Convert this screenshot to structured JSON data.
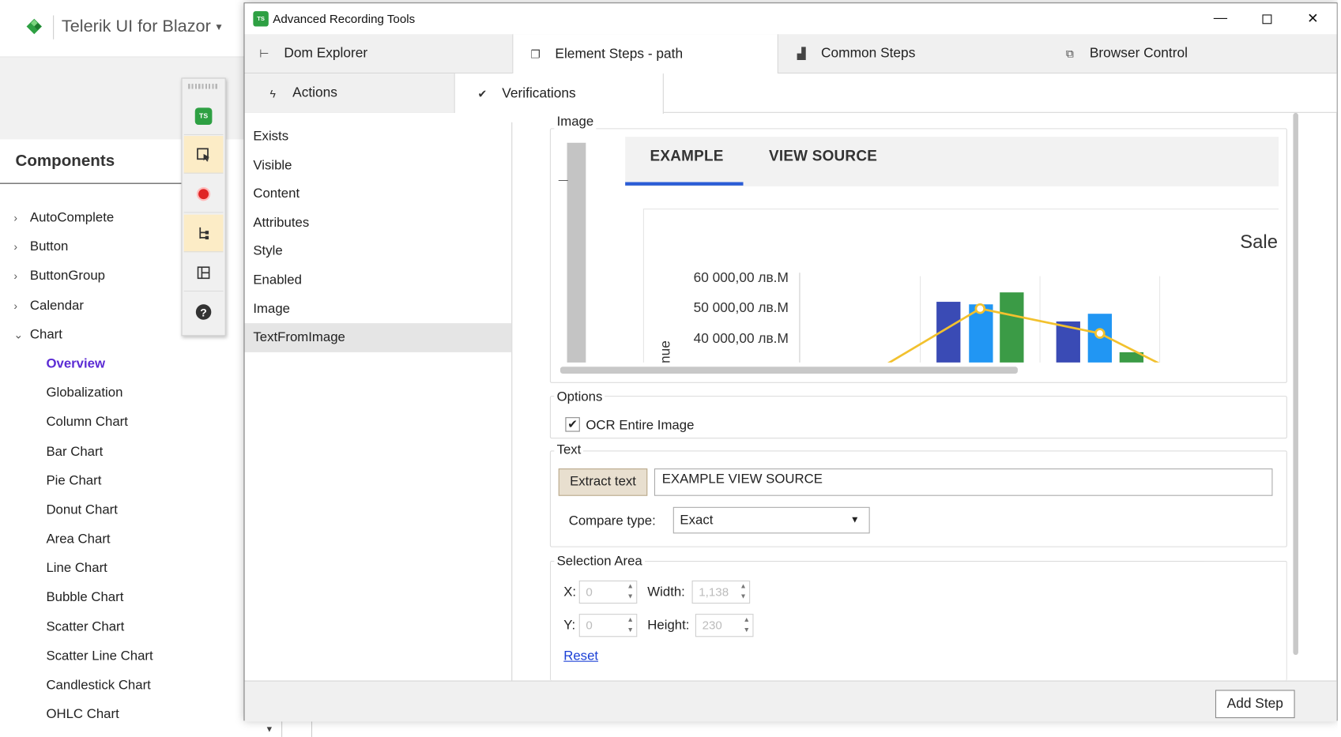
{
  "background": {
    "app_title": "Telerik UI for Blazor",
    "components_heading": "Components",
    "nav": [
      {
        "label": "AutoComplete",
        "chev": "›",
        "kind": "top"
      },
      {
        "label": "Button",
        "chev": "›",
        "kind": "top"
      },
      {
        "label": "ButtonGroup",
        "chev": "›",
        "kind": "top"
      },
      {
        "label": "Calendar",
        "chev": "›",
        "kind": "top"
      },
      {
        "label": "Chart",
        "chev": "⌄",
        "kind": "top"
      },
      {
        "label": "Overview",
        "chev": "",
        "kind": "sub active"
      },
      {
        "label": "Globalization",
        "chev": "",
        "kind": "sub"
      },
      {
        "label": "Column Chart",
        "chev": "",
        "kind": "sub"
      },
      {
        "label": "Bar Chart",
        "chev": "",
        "kind": "sub"
      },
      {
        "label": "Pie Chart",
        "chev": "",
        "kind": "sub"
      },
      {
        "label": "Donut Chart",
        "chev": "",
        "kind": "sub"
      },
      {
        "label": "Area Chart",
        "chev": "",
        "kind": "sub"
      },
      {
        "label": "Line Chart",
        "chev": "",
        "kind": "sub"
      },
      {
        "label": "Bubble Chart",
        "chev": "",
        "kind": "sub"
      },
      {
        "label": "Scatter Chart",
        "chev": "",
        "kind": "sub"
      },
      {
        "label": "Scatter Line Chart",
        "chev": "",
        "kind": "sub"
      },
      {
        "label": "Candlestick Chart",
        "chev": "",
        "kind": "sub"
      },
      {
        "label": "OHLC Chart",
        "chev": "",
        "kind": "sub"
      }
    ]
  },
  "toolbar": {
    "badge": "TS",
    "buttons": [
      "ts-logo-icon",
      "element-select-icon",
      "record-icon",
      "dom-tree-icon",
      "layout-icon",
      "help-icon"
    ]
  },
  "dialog": {
    "title": "Advanced Recording Tools",
    "app_badge": "TS",
    "tabs": [
      {
        "label": "Dom Explorer",
        "icon": "dom-tree-icon",
        "glyph": "⊢"
      },
      {
        "label": "Element Steps - path",
        "icon": "pages-icon",
        "glyph": "❐"
      },
      {
        "label": "Common Steps",
        "icon": "steps-icon",
        "glyph": "▟"
      },
      {
        "label": "Browser Control",
        "icon": "browser-icon",
        "glyph": "⧉"
      }
    ],
    "subtabs": [
      {
        "label": "Actions",
        "glyph": "ϟ"
      },
      {
        "label": "Verifications",
        "glyph": "✔"
      }
    ],
    "verifications": [
      "Exists",
      "Visible",
      "Content",
      "Attributes",
      "Style",
      "Enabled",
      "Image",
      "TextFromImage"
    ],
    "image_group": {
      "label": "Image",
      "preview": {
        "tab_example": "EXAMPLE",
        "tab_view_source": "VIEW SOURCE",
        "chart_title_fragment": "Sale",
        "y_axis_label_fragment": "nue",
        "y_ticks": [
          "60 000,00 лв.M",
          "50 000,00 лв.M",
          "40 000,00 лв.M"
        ]
      }
    },
    "options_group": {
      "label": "Options",
      "ocr_entire_image": "OCR Entire Image",
      "ocr_checked": true
    },
    "text_group": {
      "label": "Text",
      "extract_button": "Extract text",
      "text_value": "EXAMPLE VIEW SOURCE",
      "compare_label": "Compare type:",
      "compare_value": "Exact"
    },
    "selection_group": {
      "label": "Selection Area",
      "x_label": "X:",
      "x_value": "0",
      "y_label": "Y:",
      "y_value": "0",
      "width_label": "Width:",
      "width_value": "1,138",
      "height_label": "Height:",
      "height_value": "230",
      "reset": "Reset"
    },
    "add_step": "Add Step"
  },
  "colors": {
    "accent_green": "#2ea043",
    "active_nav": "#5b2bd4",
    "tab_underline": "#2b5dd6",
    "bar_dark_blue": "#3a4bb5",
    "bar_light_blue": "#2196f3",
    "bar_green": "#3b9b46",
    "line_yellow": "#f2c12e",
    "link_blue": "#1a3fd6"
  }
}
